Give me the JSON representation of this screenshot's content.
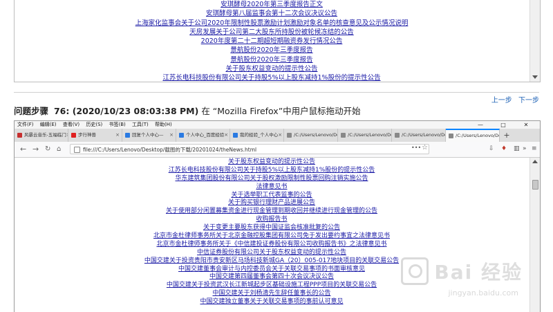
{
  "previous_screenshot": {
    "links": [
      "安琪酵母2020年第三季度报告正文",
      "安琪酵母第八届监事会第十二次会议决议公告",
      "上海家化监事会关于公司2020年限制性股票激励计划激励对象名单的核查意见及公示情况说明",
      "天房发展关于公司第二大股东所持股份被轮候冻结的公告",
      "2020年度第二十二期超短期融资券发行情况公告",
      "景航股份2020年三季度报告",
      "景航股份2020年三季度报告",
      "关于股东权益变动的提示性公告",
      "江苏长电科技股份有限公司关于持股5%以上股东减持1%股份的提示性公告"
    ]
  },
  "step_nav": {
    "prev_label": "上一步",
    "next_label": "下一步"
  },
  "step": {
    "label": "问题步骤",
    "number_time": "76: (2020/10/23 08:03:38 PM)",
    "description": "在 “Mozilla Firefox”中用户鼠标拖动开始"
  },
  "browser": {
    "menu": [
      "文件(F)",
      "编辑(E)",
      "查看(V)",
      "历史(S)",
      "书签(B)",
      "工具(T)",
      "帮助(H)"
    ],
    "window_controls": [
      "—",
      "□",
      "✕"
    ],
    "tabs": [
      {
        "label": "风暴云音乐-五福临门",
        "active": false,
        "color": "#c62f2f"
      },
      {
        "label": "步行神兽",
        "active": false,
        "color": "#e02020"
      },
      {
        "label": "回复个人中心—",
        "active": false,
        "color": "#2a7ae2"
      },
      {
        "label": "个人中心_百度经验",
        "active": false,
        "color": "#2a7ae2"
      },
      {
        "label": "我的经验_个人中心",
        "active": false,
        "color": "#2a7ae2"
      },
      {
        "label": "/C:/Users/Lenovo/Des",
        "active": false,
        "color": "#888888"
      },
      {
        "label": "/C:/Users/Lenovo/Des",
        "active": false,
        "color": "#888888"
      },
      {
        "label": "/C:/Users/Lenovo/Des",
        "active": false,
        "color": "#888888"
      },
      {
        "label": "/C:/Users/Lenovo/Des",
        "active": true,
        "color": "#888888"
      }
    ],
    "url": "file:///C:/Users/Lenovo/Desktop/截图的下载/20201024/theNews.html",
    "page_links": [
      "关于股东权益变动的提示性公告",
      "江苏长电科技股份有限公司关于持股5%以上股东减持1%股份的提示性公告",
      "华东建筑集团股份有限公司关于股权激励限制性股票回购注销实施公告",
      "法律意见书",
      "关于选举职工代表监事的公告",
      "关于购买银行理财产品进展公告",
      "关于使用部分闲置募集资金进行现金管理到期收回并继续进行现金管理的公告",
      "收购报告书",
      "关于变更主要股东获得中国证监会核准批复的公告",
      "北京市金杜律师事务所关于北京金融控股集团有限公司免于发出要约事宜之法律意见书",
      "北京市金杜律师事务所关于《中信建投证券股份有限公司收购报告书》之法律意见书",
      "中信证券股份有限公司关于股东权益变动的提示性公告",
      "中国交建关于投资贵阳市贵安新区马场科技新城GA（20）005-017地块项目的关联交易公告",
      "中国交建董事会审计与内控委员会关于关联交易事项的书面审核意见",
      "中国交建第四届董事会第四十次会议决议公告",
      "中国交建关于投资武汉长江新城起步区基础设施工程PPP项目的关联交易公告",
      "中国交建关于刘杨清先生辞任董事长的公告",
      "中国交建独立董事关于关联交易事项的事前认可意见"
    ]
  },
  "watermark": {
    "text": "Bai 经验",
    "sub": "jingyan.baidu.com"
  }
}
